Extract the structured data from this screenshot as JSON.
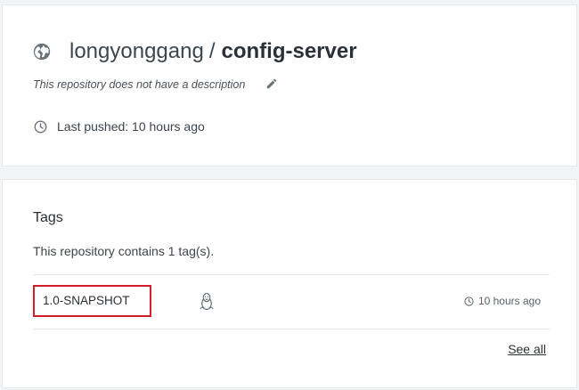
{
  "repository": {
    "namespace": "longyonggang",
    "separator": "/",
    "name": "config-server",
    "description": "This repository does not have a description",
    "last_pushed": "Last pushed: 10 hours ago"
  },
  "tags": {
    "title": "Tags",
    "count_text": "This repository contains 1 tag(s).",
    "items": [
      {
        "name": "1.0-SNAPSHOT",
        "os_icon": "linux-icon",
        "time": "10 hours ago"
      }
    ],
    "see_all_label": "See all"
  },
  "colors": {
    "highlight_border": "#d21f2b",
    "icon_gray": "#6b737a"
  }
}
